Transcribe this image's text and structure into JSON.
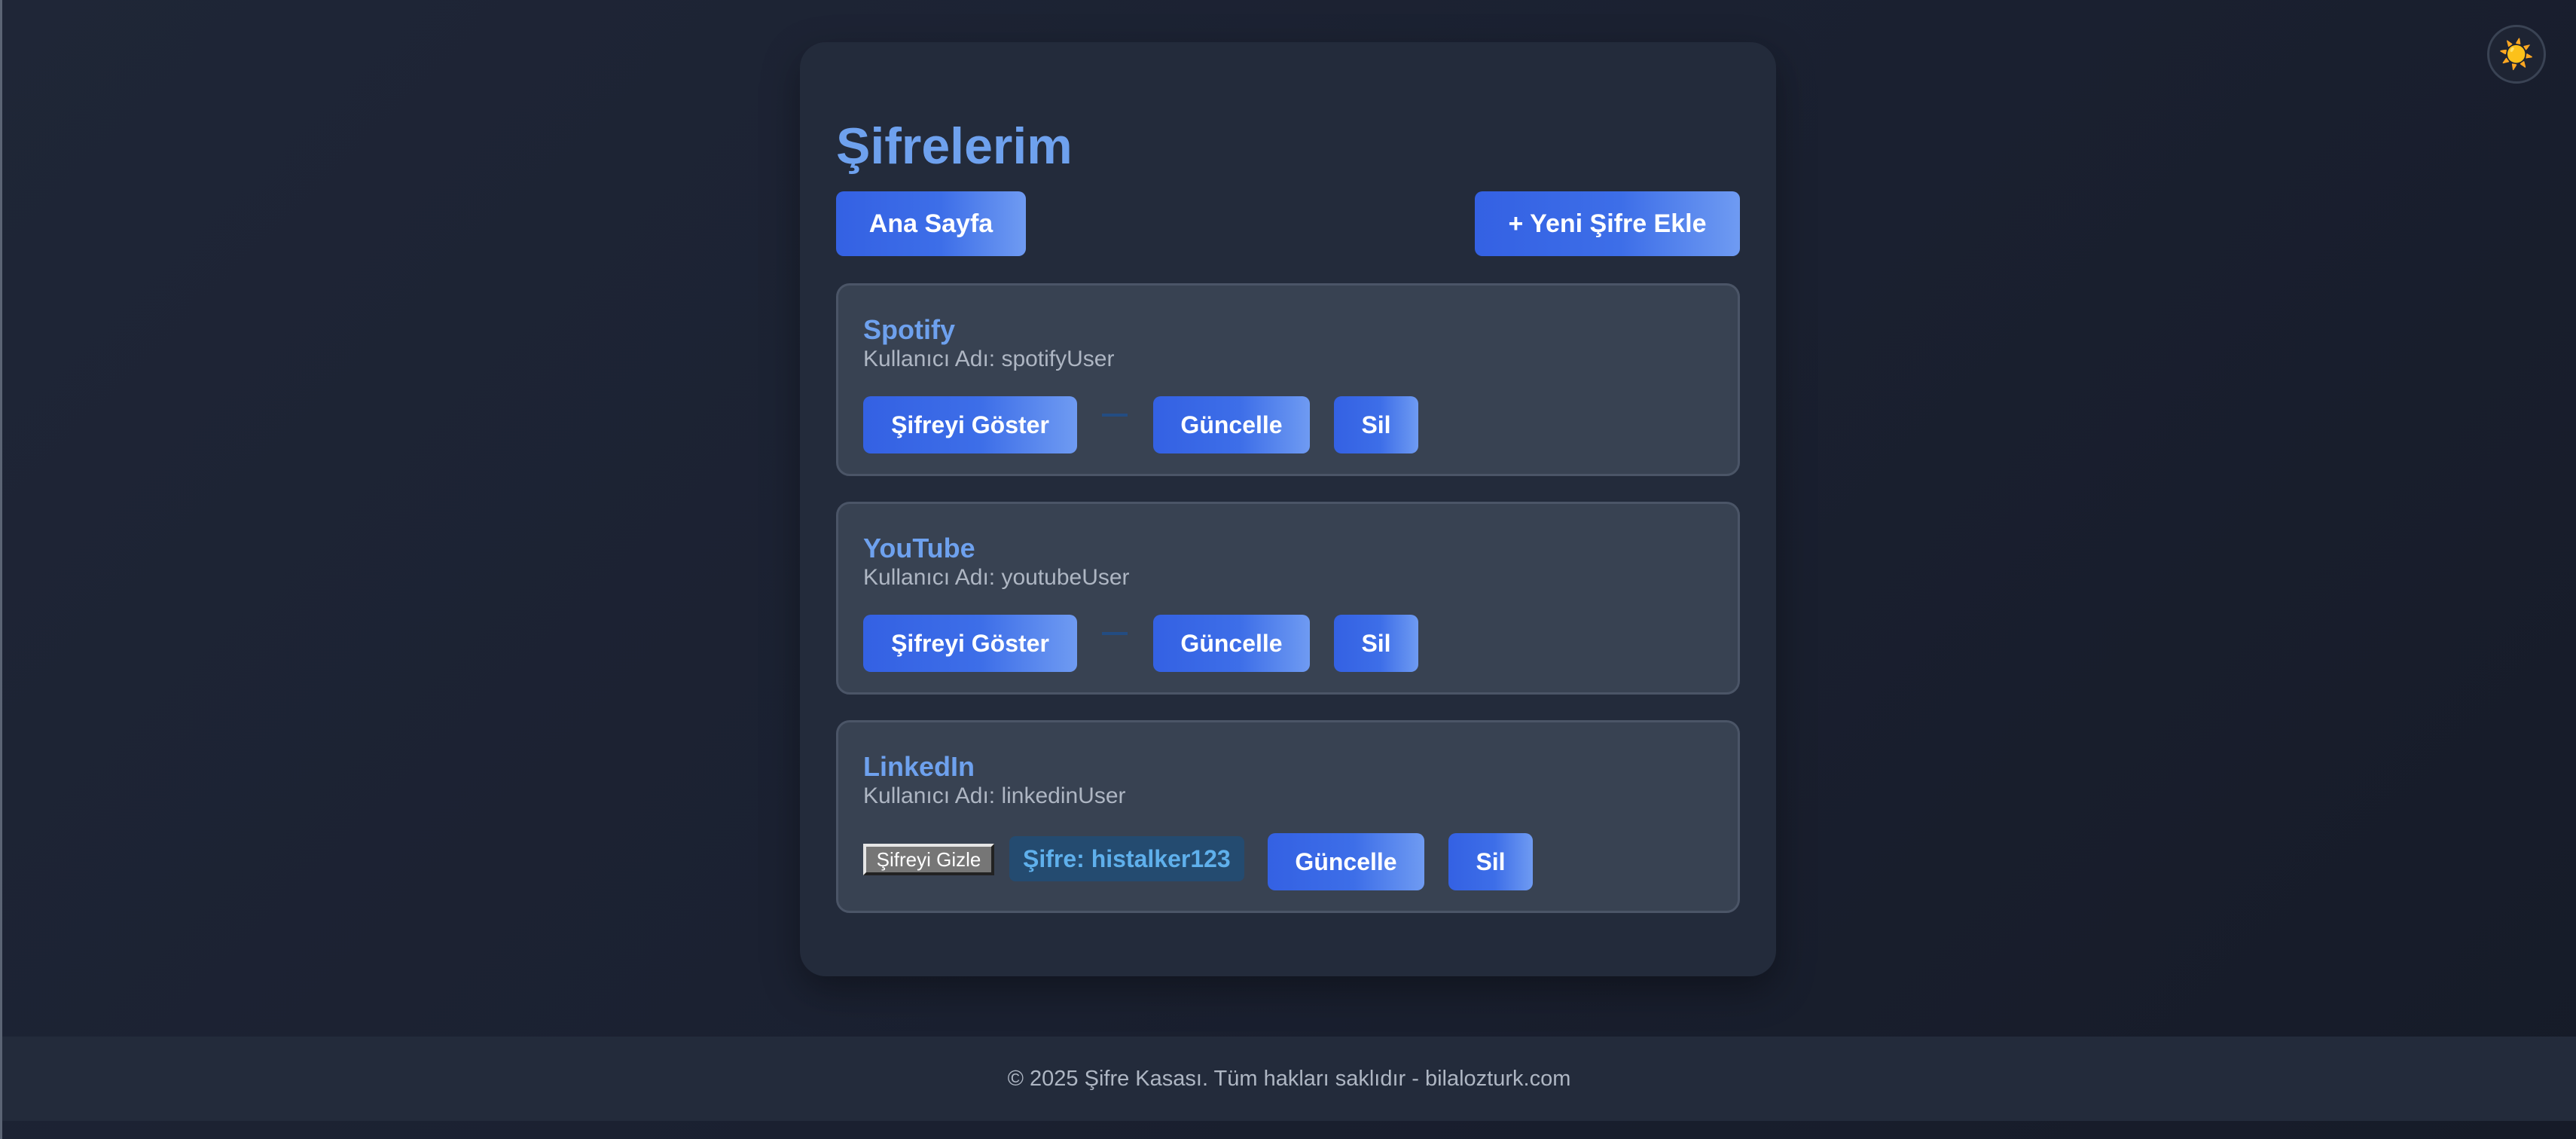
{
  "theme_toggle": {
    "icon": "sun-icon",
    "glyph": "☀️"
  },
  "header": {
    "title": "Şifrelerim",
    "home_label": "Ana Sayfa",
    "add_label": "+ Yeni Şifre Ekle"
  },
  "entries": [
    {
      "name": "Spotify",
      "username_text": "Kullanıcı Adı: spotifyUser",
      "toggle_label": "Şifreyi Göster",
      "update_label": "Güncelle",
      "delete_label": "Sil"
    },
    {
      "name": "YouTube",
      "username_text": "Kullanıcı Adı: youtubeUser",
      "toggle_label": "Şifreyi Göster",
      "update_label": "Güncelle",
      "delete_label": "Sil"
    },
    {
      "name": "LinkedIn",
      "username_text": "Kullanıcı Adı: linkedinUser",
      "toggle_label": "Şifreyi Gizle",
      "password_text": "Şifre: histalker123",
      "update_label": "Güncelle",
      "delete_label": "Sil"
    }
  ],
  "footer": {
    "text": "© 2025 Şifre Kasası. Tüm hakları saklıdır - bilalozturk.com"
  },
  "colors": {
    "accent": "#6ea1ee",
    "button_start": "#3461e3",
    "button_end": "#6f9bf2",
    "background": "#1a2030",
    "card": "#232b3b",
    "entry": "#384252",
    "password_text": "#5fb0ec"
  }
}
